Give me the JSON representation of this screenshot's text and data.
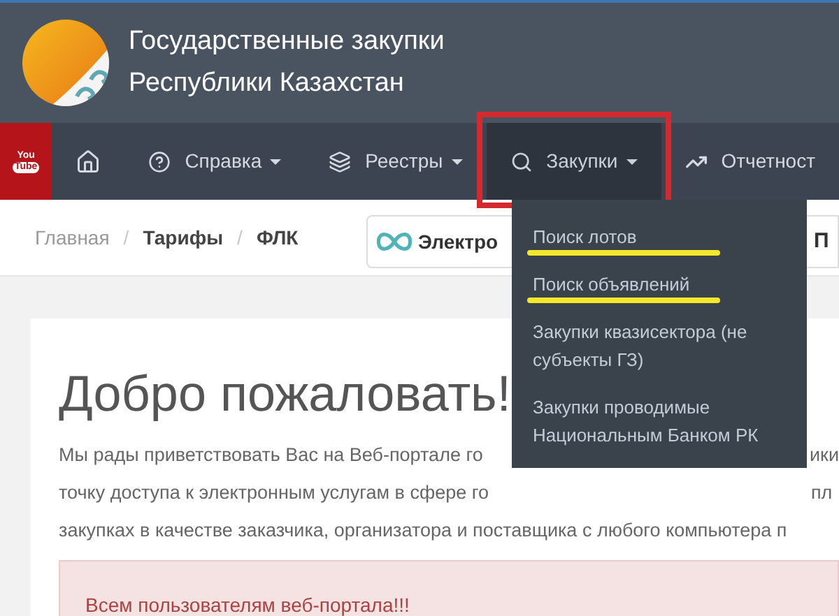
{
  "header": {
    "title_lines": [
      "Государственные закупки",
      "Республики Казахстан"
    ]
  },
  "nav": [
    {
      "kind": "youtube",
      "label": "You Tube",
      "selected": false
    },
    {
      "kind": "home",
      "selected": false
    },
    {
      "kind": "menu",
      "label": "Справка",
      "selected": false,
      "annotated": false
    },
    {
      "kind": "menu",
      "label": "Реестры",
      "selected": false,
      "annotated": false
    },
    {
      "kind": "menu",
      "label": "Закупки",
      "selected": true,
      "annotated": true
    },
    {
      "kind": "link",
      "label": "Отчетност",
      "selected": false,
      "annotated": false
    }
  ],
  "dropdown": [
    {
      "label": "Поиск лотов",
      "highlighted": true
    },
    {
      "label": "Поиск объявлений",
      "highlighted": true
    },
    {
      "label": "Закупки квазисектора (не субъекты ГЗ)",
      "highlighted": false
    },
    {
      "label": "Закупки проводимые Национальным Банком РК",
      "highlighted": false
    }
  ],
  "breadcrumb": [
    {
      "label": "Главная",
      "current": false
    },
    {
      "label": "Тарифы",
      "current": true
    },
    {
      "label": "ФЛК",
      "current": true
    }
  ],
  "breadcrumb_separator": "/",
  "service_card": {
    "label": "Электро",
    "right_label": "П"
  },
  "welcome": {
    "heading": "Добро пожаловать!",
    "lines": [
      {
        "left": "Мы рады приветствовать Вас на Веб-портале го",
        "right": "ики"
      },
      {
        "left": "точку доступа к электронным услугам в сфере го",
        "right": "пл"
      },
      {
        "left": "закупках в качестве заказчика, организатора и поставщика с любого компьютера п"
      }
    ],
    "alert": "Всем пользователям веб-портала!!!"
  }
}
